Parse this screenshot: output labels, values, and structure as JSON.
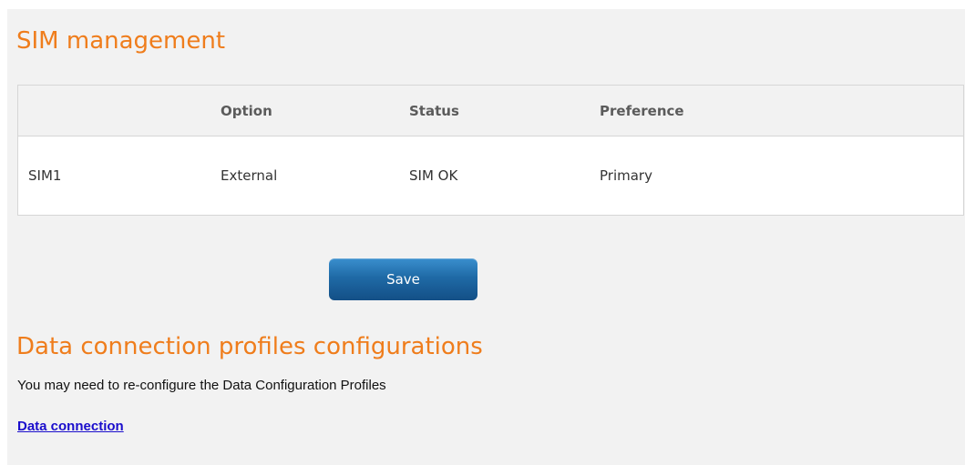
{
  "sim_management": {
    "title": "SIM management",
    "table": {
      "headers": [
        "",
        "Option",
        "Status",
        "Preference"
      ],
      "rows": [
        [
          "SIM1",
          "External",
          "SIM OK",
          "Primary"
        ]
      ]
    },
    "save_label": "Save"
  },
  "data_profiles": {
    "title": "Data connection profiles configurations",
    "description": "You may need to re-configure the Data Configuration Profiles",
    "link_label": "Data connection"
  },
  "colors": {
    "heading": "#ef7d1c",
    "button": "#1f6aa6",
    "link": "#1a0dcc",
    "panel_background": "#f2f2f2"
  }
}
